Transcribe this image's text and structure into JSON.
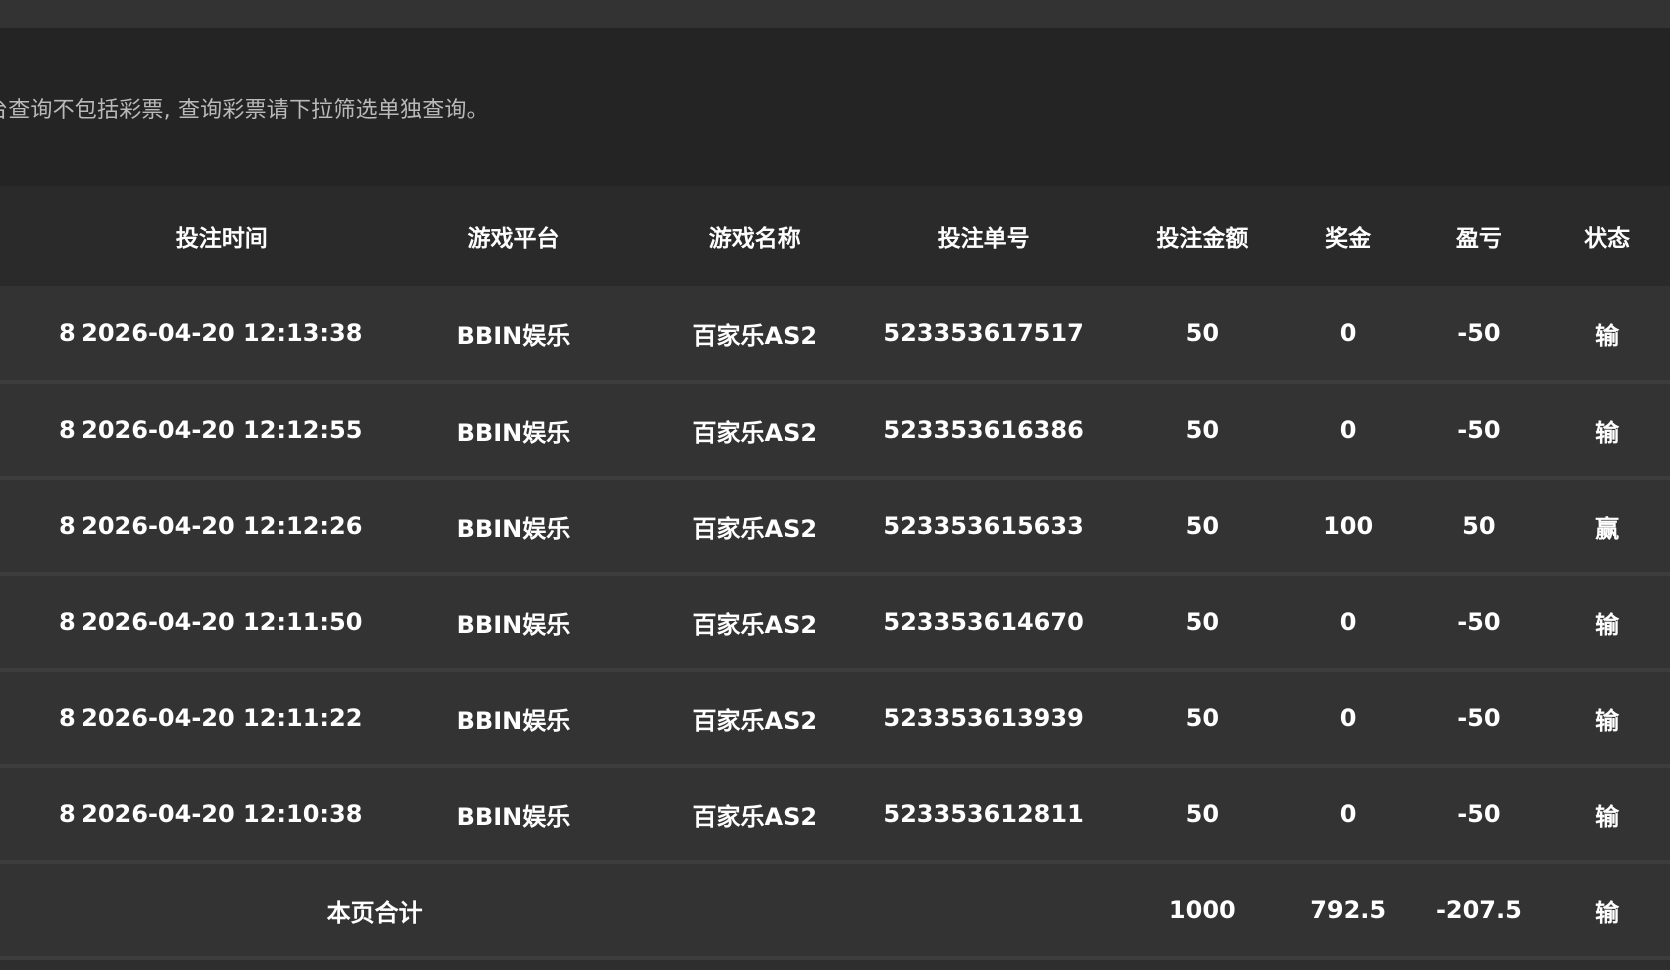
{
  "notice": {
    "text": "台查询不包括彩票, 查询彩票请下拉筛选单独查询。"
  },
  "table": {
    "headers": {
      "time": "投注时间",
      "platform": "游戏平台",
      "game": "游戏名称",
      "order": "投注单号",
      "amount": "投注金额",
      "prize": "奖金",
      "profit": "盈亏",
      "status": "状态"
    },
    "rows": [
      {
        "id_tail": "8",
        "time": "2026-04-20 12:13:38",
        "platform": "BBIN娱乐",
        "game": "百家乐AS2",
        "order": "523353617517",
        "amount": "50",
        "prize": "0",
        "profit": "-50",
        "status": "输"
      },
      {
        "id_tail": "8",
        "time": "2026-04-20 12:12:55",
        "platform": "BBIN娱乐",
        "game": "百家乐AS2",
        "order": "523353616386",
        "amount": "50",
        "prize": "0",
        "profit": "-50",
        "status": "输"
      },
      {
        "id_tail": "8",
        "time": "2026-04-20 12:12:26",
        "platform": "BBIN娱乐",
        "game": "百家乐AS2",
        "order": "523353615633",
        "amount": "50",
        "prize": "100",
        "profit": "50",
        "status": "赢"
      },
      {
        "id_tail": "8",
        "time": "2026-04-20 12:11:50",
        "platform": "BBIN娱乐",
        "game": "百家乐AS2",
        "order": "523353614670",
        "amount": "50",
        "prize": "0",
        "profit": "-50",
        "status": "输"
      },
      {
        "id_tail": "8",
        "time": "2026-04-20 12:11:22",
        "platform": "BBIN娱乐",
        "game": "百家乐AS2",
        "order": "523353613939",
        "amount": "50",
        "prize": "0",
        "profit": "-50",
        "status": "输"
      },
      {
        "id_tail": "8",
        "time": "2026-04-20 12:10:38",
        "platform": "BBIN娱乐",
        "game": "百家乐AS2",
        "order": "523353612811",
        "amount": "50",
        "prize": "0",
        "profit": "-50",
        "status": "输"
      }
    ],
    "summary": {
      "label": "本页合计",
      "amount": "1000",
      "prize": "792.5",
      "profit": "-207.5",
      "status": "输"
    }
  }
}
